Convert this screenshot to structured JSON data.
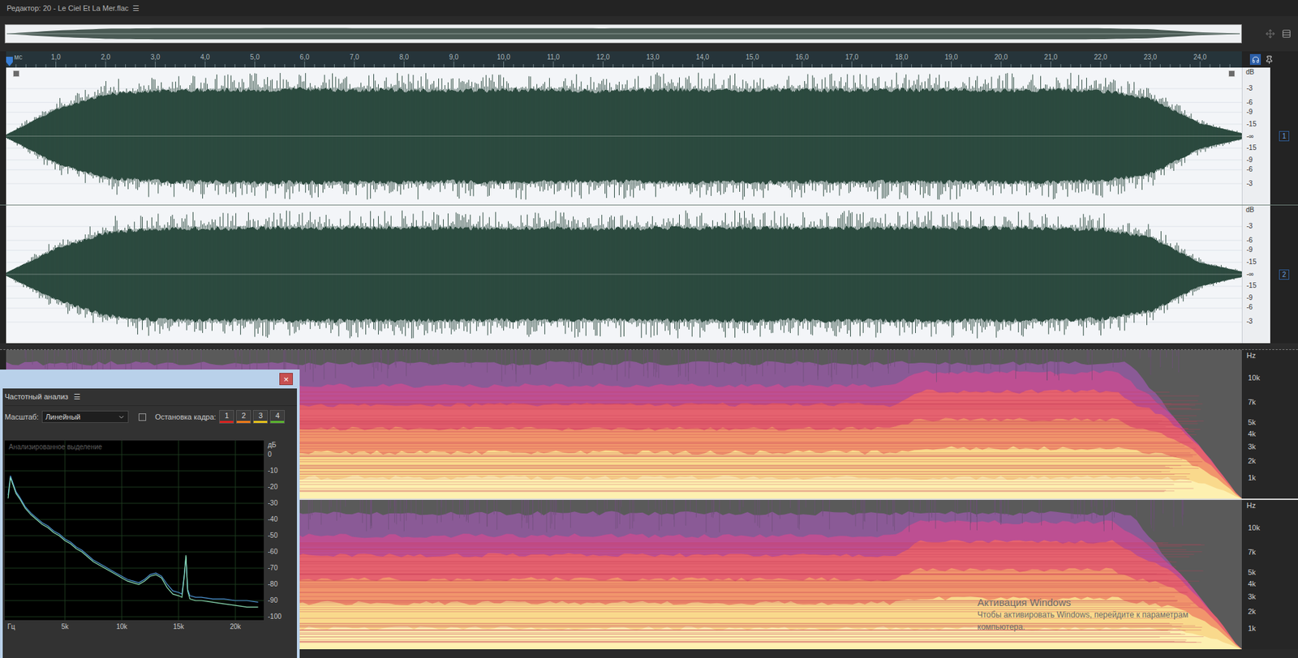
{
  "window": {
    "title": "Редактор: 20 - Le Ciel Et La Mer.flac",
    "menu": "☰"
  },
  "ruler": {
    "start_label": "мс",
    "ticks": [
      "1,0",
      "2,0",
      "3,0",
      "4,0",
      "5,0",
      "6,0",
      "7,0",
      "8,0",
      "9,0",
      "10,0",
      "11,0",
      "12,0",
      "13,0",
      "14,0",
      "15,0",
      "16,0",
      "17,0",
      "18,0",
      "19,0",
      "20,0",
      "21,0",
      "22,0",
      "23,0",
      "24,0"
    ]
  },
  "waveform": {
    "unit": "dB",
    "ticks": [
      "-3",
      "-6",
      "-9",
      "-15",
      "-∞",
      "-15",
      "-9",
      "-6",
      "-3"
    ],
    "channels": [
      {
        "name": "1",
        "envelope": [
          0.03,
          0.55,
          0.86,
          0.93,
          0.95,
          0.95,
          0.96,
          0.95,
          0.95,
          0.94,
          0.95,
          0.95,
          0.92,
          0.95,
          0.95,
          0.95,
          0.95,
          0.94,
          0.95,
          0.95,
          0.95,
          0.95,
          0.93,
          0.78,
          0.26,
          0.02
        ]
      },
      {
        "name": "2",
        "envelope": [
          0.03,
          0.52,
          0.85,
          0.93,
          0.95,
          0.94,
          0.95,
          0.95,
          0.95,
          0.95,
          0.94,
          0.95,
          0.93,
          0.95,
          0.95,
          0.95,
          0.94,
          0.95,
          0.95,
          0.95,
          0.95,
          0.94,
          0.92,
          0.76,
          0.24,
          0.02
        ]
      }
    ]
  },
  "spectrogram": {
    "unit": "Hz",
    "ticks": [
      "10k",
      "7k",
      "5k",
      "4k",
      "3k",
      "2k",
      "1k"
    ]
  },
  "frequency_analysis": {
    "close": "×",
    "title": "Частотный анализ",
    "menu": "☰",
    "scale_label": "Масштаб:",
    "scale_value": "Линейный",
    "freeze_label": "Остановка кадра:",
    "freeze_buttons": [
      {
        "label": "1",
        "color": "#d9231f",
        "selected": false
      },
      {
        "label": "2",
        "color": "#f07a18",
        "selected": false
      },
      {
        "label": "3",
        "color": "#e8c21a",
        "selected": false
      },
      {
        "label": "4",
        "color": "#5ab52e",
        "selected": false
      }
    ],
    "chart": {
      "title": "Анализированное выделение",
      "y_unit": "дБ",
      "y_ticks": [
        "0",
        "-10",
        "-20",
        "-30",
        "-40",
        "-50",
        "-60",
        "-70",
        "-80",
        "-90",
        "-100"
      ],
      "x_unit": "Гц",
      "x_ticks": [
        "5k",
        "10k",
        "15k",
        "20k"
      ],
      "frequencies": [
        0,
        200,
        400,
        700,
        1000,
        1500,
        2000,
        2500,
        3000,
        3500,
        4000,
        4500,
        5000,
        5500,
        6000,
        6500,
        7000,
        7500,
        8000,
        8500,
        9000,
        9500,
        10000,
        10500,
        11000,
        11500,
        12000,
        12500,
        13000,
        13500,
        14000,
        14500,
        15000,
        15300,
        15500,
        15650,
        15800,
        16000,
        16500,
        17000,
        18000,
        19000,
        20000,
        21000,
        22000
      ],
      "series": [
        {
          "color": "#4f97d8",
          "values": [
            -25,
            -13,
            -17,
            -23,
            -26,
            -32,
            -36,
            -39,
            -42,
            -44,
            -47,
            -49,
            -52,
            -54,
            -57,
            -59,
            -62,
            -65,
            -67,
            -69,
            -71,
            -73,
            -75,
            -77,
            -78,
            -79,
            -77,
            -74,
            -73,
            -75,
            -80,
            -84,
            -85,
            -86,
            -74,
            -63,
            -83,
            -87,
            -88,
            -88,
            -89,
            -89,
            -90,
            -90,
            -91
          ]
        },
        {
          "color": "#8fe3b8",
          "values": [
            -27,
            -14,
            -18,
            -24,
            -27,
            -33,
            -37,
            -40,
            -43,
            -45,
            -48,
            -50,
            -53,
            -55,
            -58,
            -60,
            -63,
            -66,
            -68,
            -70,
            -72,
            -74,
            -76,
            -78,
            -79,
            -80,
            -78,
            -75,
            -74,
            -76,
            -82,
            -86,
            -87,
            -88,
            -75,
            -62,
            -84,
            -89,
            -90,
            -90,
            -91,
            -92,
            -93,
            -94,
            -94
          ]
        }
      ]
    }
  },
  "watermark": {
    "lines": [
      "Активация Windows",
      "Чтобы активировать Windows, перейдите к параметрам",
      "компьютера."
    ]
  }
}
